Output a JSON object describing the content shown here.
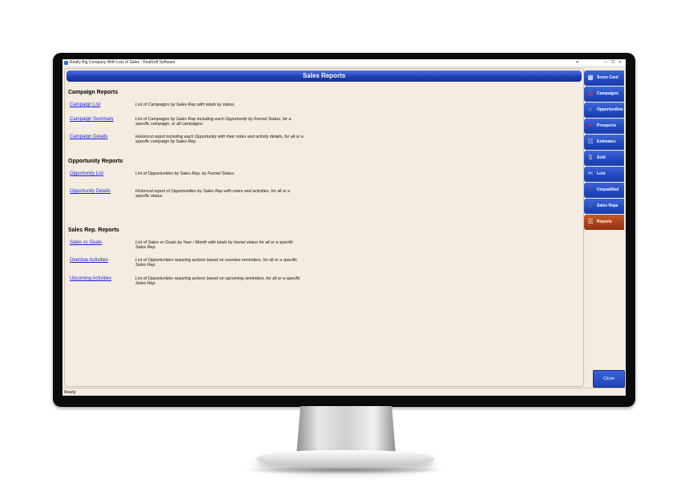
{
  "window": {
    "title": "Really Big Company With Lots of Sales - KindSoft Software",
    "menu_glyph": "••"
  },
  "header": {
    "title": "Sales Reports"
  },
  "sections": [
    {
      "title": "Campaign Reports",
      "items": [
        {
          "link": "Campaign List",
          "desc": "List of Campaigns by Sales Rep with totals by status."
        },
        {
          "link": "Campaign Summary",
          "desc": "List of Campaigns by Sales Rep including each Opportunity by Funnel Status, for a specific campaign, or all campaigns."
        },
        {
          "link": "Campaign Details",
          "desc": "Historical report including each Opportunity with their notes and activity details, for all or a specific campaign by Sales Rep."
        }
      ]
    },
    {
      "title": "Opportunity Reports",
      "items": [
        {
          "link": "Opportunity List",
          "desc": "List of Opportunities by Sales Rep, by Funnel Status."
        },
        {
          "link": "Opportunity Details",
          "desc": "Historical report of Opportunities by Sales Rep with notes and activities, for all or a specific status."
        }
      ]
    },
    {
      "title": "Sales Rep. Reports",
      "items": [
        {
          "link": "Sales vs Goals",
          "desc": "List of Sales vs Goals by Year / Month with totals by funnel status for all or a specific Sales Rep."
        },
        {
          "link": "Overdue Activities",
          "desc": "List of Opportunities requiring actions based on overdue reminders, for all or a specific Sales Rep."
        },
        {
          "link": "Upcoming Activities",
          "desc": "List of Opportunities requiring actions based on upcoming reminders, for all or a specific Sales Rep."
        }
      ]
    }
  ],
  "nav": [
    {
      "label": "Score Card",
      "icon": "scorecard-icon",
      "glyph": "▦",
      "icon_color": "#f4f4f4"
    },
    {
      "label": "Campaigns",
      "icon": "campaigns-icon",
      "glyph": "◎",
      "icon_color": "#e04a3c"
    },
    {
      "label": "Opportunities",
      "icon": "opportunities-icon",
      "glyph": "⌕",
      "icon_color": "#f2c94c"
    },
    {
      "label": "Prospects",
      "icon": "prospects-icon",
      "glyph": "♥",
      "icon_color": "#d93030"
    },
    {
      "label": "Estimates",
      "icon": "estimates-icon",
      "glyph": "☷",
      "icon_color": "#f4f4f4"
    },
    {
      "label": "Sold",
      "icon": "sold-icon",
      "glyph": "$",
      "icon_color": "#f0c24a"
    },
    {
      "label": "Lost",
      "icon": "lost-icon",
      "glyph": "✂",
      "icon_color": "#e8e8e8"
    },
    {
      "label": "Unqualified",
      "icon": "unqualified-icon",
      "glyph": "!",
      "icon_color": "#e23a2a"
    },
    {
      "label": "Sales Reps",
      "icon": "sales-reps-icon",
      "glyph": "☺",
      "icon_color": "#3fa34d"
    },
    {
      "label": "Reports",
      "icon": "reports-icon",
      "glyph": "☰",
      "icon_color": "#f4f4f4",
      "active": true
    }
  ],
  "close_button": "Close",
  "status": "Ready"
}
